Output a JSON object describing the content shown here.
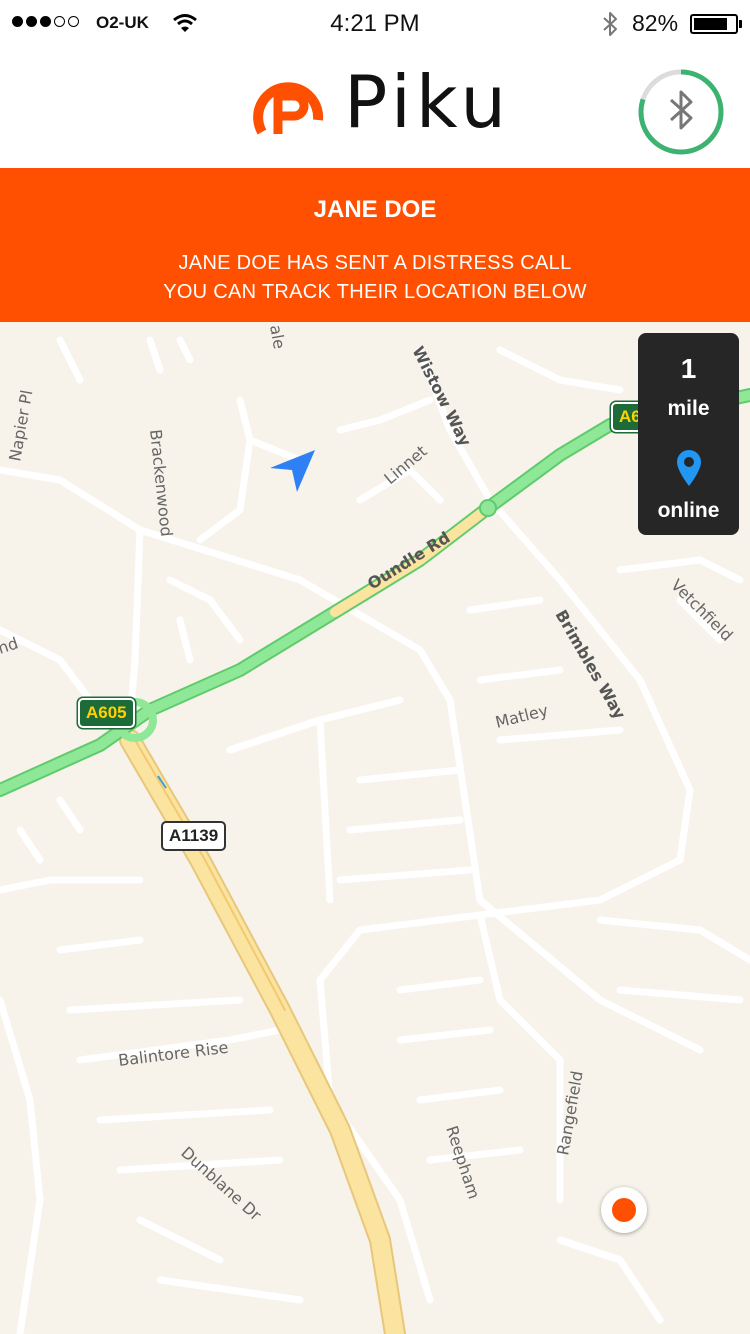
{
  "status_bar": {
    "signal_bars": 3,
    "signal_total": 5,
    "carrier": "O2-UK",
    "time": "4:21 PM",
    "battery_percent": "82%",
    "battery_level": 0.82,
    "icons": [
      "wifi-icon",
      "bluetooth-icon",
      "battery-icon"
    ]
  },
  "header": {
    "brand": "Piku",
    "brand_color": "#ff4f00",
    "bluetooth_button": {
      "icon": "bluetooth-icon",
      "ring_color": "#3cb371",
      "ring_progress": 0.8
    }
  },
  "alert": {
    "title": "JANE DOE",
    "line1": "JANE DOE HAS SENT A DISTRESS CALL",
    "line2": "YOU CAN TRACK THEIR LOCATION BELOW",
    "background": "#ff4f00"
  },
  "info_panel": {
    "distance_value": "1",
    "distance_unit": "mile",
    "status": "online",
    "pin_icon": "location-pin-icon",
    "pin_color": "#2196f3"
  },
  "map": {
    "road_labels": {
      "wistow_way": "Wistow Way",
      "napier_pl": "Napier Pl",
      "brackenwood": "Brackenwood",
      "linnet": "Linnet",
      "oundle_rd": "Oundle Rd",
      "brimbles_way": "Brimbles Way",
      "vetchfield": "Vetchfield",
      "matley": "Matley",
      "balintore_rise": "Balintore Rise",
      "dunblane_dr": "Dunblane Dr",
      "reepham": "Reepham",
      "rangefield": "Rangefield",
      "ale": "ale",
      "nd": "nd"
    },
    "shields": {
      "a605_left": "A605",
      "a605_right": "A6",
      "a1139": "A1139"
    },
    "icons": [
      "navigation-arrow-icon",
      "user-location-marker"
    ],
    "primary_road_color": "#7fe08a",
    "motorway_color": "#fbe3a0"
  }
}
